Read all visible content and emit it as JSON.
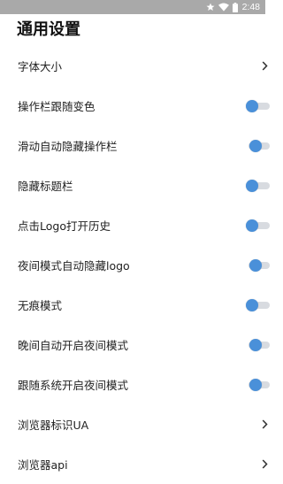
{
  "status_bar": {
    "time": "2:48",
    "icons": [
      "star-icon",
      "wifi-icon",
      "battery-icon"
    ]
  },
  "page": {
    "title": "通用设置"
  },
  "settings": [
    {
      "label": "字体大小",
      "control": "chevron"
    },
    {
      "label": "操作栏跟随变色",
      "control": "toggle",
      "value": true
    },
    {
      "label": "滑动自动隐藏操作栏",
      "control": "toggle",
      "value": true
    },
    {
      "label": "隐藏标题栏",
      "control": "toggle",
      "value": true
    },
    {
      "label": "点击Logo打开历史",
      "control": "toggle",
      "value": true
    },
    {
      "label": "夜间模式自动隐藏logo",
      "control": "toggle",
      "value": true
    },
    {
      "label": "无痕模式",
      "control": "toggle",
      "value": true
    },
    {
      "label": "晚间自动开启夜间模式",
      "control": "toggle",
      "value": true
    },
    {
      "label": "跟随系统开启夜间模式",
      "control": "toggle",
      "value": true
    },
    {
      "label": "浏览器标识UA",
      "control": "chevron"
    },
    {
      "label": "浏览器api",
      "control": "chevron"
    }
  ],
  "colors": {
    "accent": "#4a90d9",
    "track": "#d8dbe0",
    "status_bar": "#a9a9a9"
  }
}
